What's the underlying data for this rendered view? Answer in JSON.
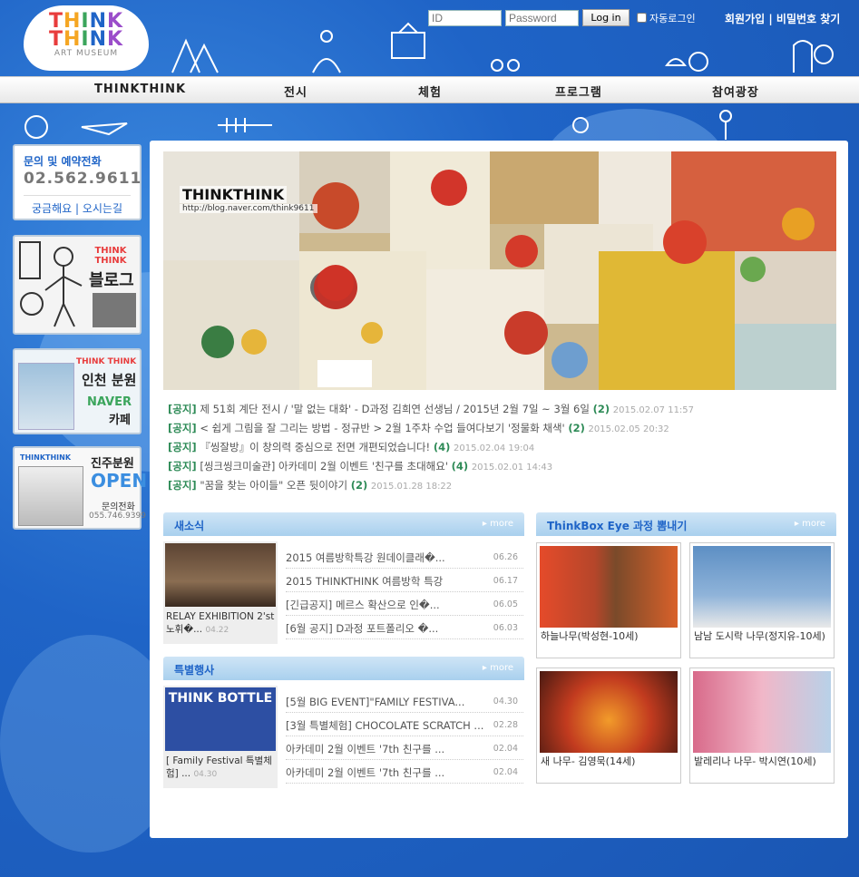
{
  "logo": {
    "line1": "THINK",
    "line2": "THINK",
    "line3": "ART MUSEUM"
  },
  "login": {
    "id_placeholder": "ID",
    "pw_placeholder": "Password",
    "button": "Log in",
    "auto_label": "자동로그인"
  },
  "toplinks": {
    "join": "회원가입",
    "sep": " | ",
    "findpw": "비밀번호 찾기"
  },
  "nav": [
    "THINKTHINK",
    "전시",
    "체험",
    "프로그램",
    "참여광장"
  ],
  "sidebar": {
    "contact_title": "문의 및 예약전화",
    "phone": "02.562.9611",
    "faq": "궁금해요",
    "sep": " | ",
    "map": "오시는길",
    "blog_brand": "THINK THINK",
    "blog_label": "블로그",
    "incheon_brand": "THINK THINK",
    "incheon_title": "인천 분원",
    "incheon_naver": "NAVER",
    "incheon_cafe": "카페",
    "jinju_brand": "THINKTHINK",
    "jinju_title": "진주분원",
    "jinju_open": "OPEN",
    "jinju_call": "문의전화",
    "jinju_phone": "055.746.9399"
  },
  "hero": {
    "title": "THINKTHINK",
    "url": "http://blog.naver.com/think9611"
  },
  "notices": [
    {
      "tag": "[공지]",
      "text": "제 51회 계단 전시 / '말 없는 대화' - D과정 김희연 선생님 / 2015년 2월 7일 ~ 3월 6일",
      "count": "(2)",
      "date": "2015.02.07 11:57"
    },
    {
      "tag": "[공지]",
      "text": "< 쉽게 그림을 잘 그리는 방법 - 정규반 > 2월 1주차 수업 들여다보기 '정물화 채색'",
      "count": "(2)",
      "date": "2015.02.05 20:32"
    },
    {
      "tag": "[공지]",
      "text": "『씽잘방』이 창의력 중심으로 전면 개편되었습니다!",
      "count": "(4)",
      "date": "2015.02.04 19:04"
    },
    {
      "tag": "[공지]",
      "text": "[씽크씽크미술관] 아카데미 2월 이벤트 '친구를 초대해요'",
      "count": "(4)",
      "date": "2015.02.01 14:43"
    },
    {
      "tag": "[공지]",
      "text": "\"꿈을 찾는 아이들\" 오픈 뒷이야기",
      "count": "(2)",
      "date": "2015.01.28 18:22"
    }
  ],
  "news": {
    "title": "새소식",
    "more": "more",
    "thumb_caption": "RELAY EXHIBITION 2'st 노휘�...",
    "thumb_date": "04.22",
    "items": [
      {
        "text": "2015 여름방학특강 원데이클래�...",
        "date": "06.26"
      },
      {
        "text": "2015 THINKTHINK 여름방학 특강",
        "date": "06.17"
      },
      {
        "text": "[긴급공지] 메르스 확산으로 인�...",
        "date": "06.05"
      },
      {
        "text": "[6월 공지] D과정 포트폴리오 �...",
        "date": "06.03"
      }
    ]
  },
  "events": {
    "title": "특별행사",
    "more": "more",
    "thumb_text": "THINK BOTTLE",
    "thumb_caption": "[ Family Festival 특별체험] ...",
    "thumb_date": "04.30",
    "items": [
      {
        "text": "[5월 BIG EVENT]\"FAMILY FESTIVA...",
        "date": "04.30"
      },
      {
        "text": "[3월 특별체험] CHOCOLATE SCRATCH ...",
        "date": "02.28"
      },
      {
        "text": "아카데미 2월 이벤트 '7th 친구를 ...",
        "date": "02.04"
      },
      {
        "text": "아카데미 2월 이벤트 '7th 친구를 ...",
        "date": "02.04"
      }
    ]
  },
  "thinkbox": {
    "title": "ThinkBox Eye 과정 뽐내기",
    "more": "more",
    "items": [
      {
        "caption": "하늘나무(박성현-10세)",
        "color": "#b5462a"
      },
      {
        "caption": "남남 도시락 나무(정지유-10세)",
        "color": "#5d8fc4"
      },
      {
        "caption": "새 나무- 김영묵(14세)",
        "color": "#c23b1f"
      },
      {
        "caption": "발레리나 나무- 박시연(10세)",
        "color": "#d86a8a"
      }
    ]
  },
  "colors": {
    "accent": "#1f64c7",
    "notice_green": "#2e8b57",
    "background": "#1f64c7"
  }
}
